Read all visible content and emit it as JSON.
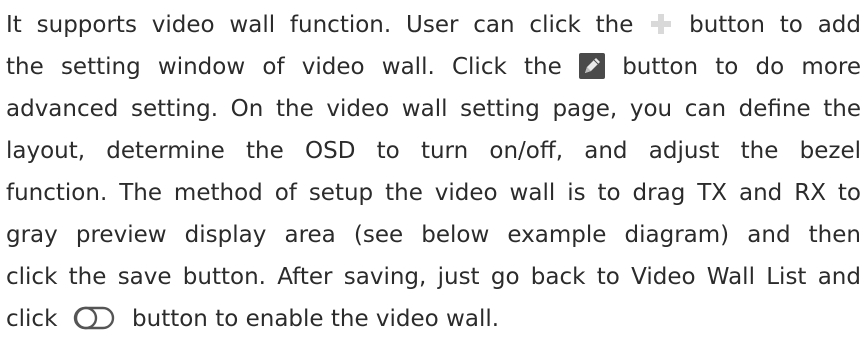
{
  "paragraph": {
    "line1_a": "It supports video wall function. User can click the",
    "line1_b": "button to add",
    "line2_a": "the setting window of video wall. Click the",
    "line2_b": "button to do more",
    "line3": "advanced setting. On the video wall setting page, you can define the",
    "line4": "layout, determine the OSD to turn on/off, and adjust the bezel",
    "line5": "function. The method of setup the video wall is to drag TX and RX to",
    "line6": "gray preview display area (see below example diagram) and then",
    "line7": "click the save button. After saving, just go back to Video Wall List and",
    "line8_a": "click",
    "line8_b": "button to enable the video wall."
  },
  "icons": {
    "add": "plus-icon",
    "edit": "pencil-icon",
    "toggle": "toggle-switch-icon"
  },
  "colors": {
    "text": "#2b2b2b",
    "plus_icon": "#d9d9d9",
    "edit_icon_bg": "#4a4a4a",
    "toggle_outline": "#555555"
  }
}
